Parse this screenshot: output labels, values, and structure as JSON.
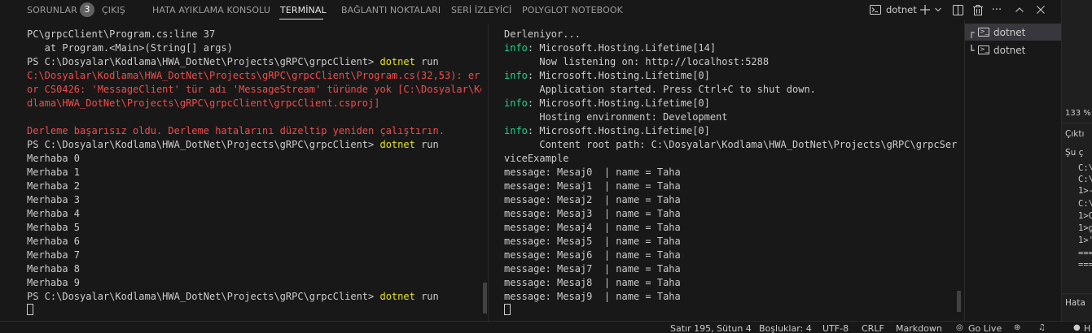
{
  "tabs": {
    "problems": "SORUNLAR",
    "problems_count": "3",
    "output": "ÇIKIŞ",
    "debug_console": "HATA AYIKLAMA KONSOLU",
    "terminal": "TERMİNAL",
    "ports": "BAĞLANTI NOKTALARI",
    "serial_monitor": "SERİ İZLEYİCİ",
    "polyglot": "POLYGLOT NOTEBOOK"
  },
  "toolbar": {
    "terminal_name": "dotnet"
  },
  "left_terminal": {
    "lines": [
      {
        "t": "PC\\grpcClient\\Program.cs:line 37",
        "c": "default"
      },
      {
        "t": "   at Program.<Main>(String[] args)",
        "c": "default"
      },
      {
        "t": "PS C:\\Dosyalar\\Kodlama\\HWA_DotNet\\Projects\\gRPC\\grpcClient> ",
        "c": "default",
        "cmd": "dotnet",
        "arg": " run"
      },
      {
        "t": "C:\\Dosyalar\\Kodlama\\HWA_DotNet\\Projects\\gRPC\\grpcClient\\Program.cs(32,53): err",
        "c": "err"
      },
      {
        "t": "or CS0426: 'MessageClient' tür adı 'MessageStream' türünde yok [C:\\Dosyalar\\Ko",
        "c": "err"
      },
      {
        "t": "dlama\\HWA_DotNet\\Projects\\gRPC\\grpcClient\\grpcClient.csproj]",
        "c": "err"
      },
      {
        "t": "",
        "c": "default"
      },
      {
        "t": "Derleme başarısız oldu. Derleme hatalarını düzeltip yeniden çalıştırın.",
        "c": "err"
      },
      {
        "t": "PS C:\\Dosyalar\\Kodlama\\HWA_DotNet\\Projects\\gRPC\\grpcClient> ",
        "c": "default",
        "cmd": "dotnet",
        "arg": " run"
      },
      {
        "t": "Merhaba 0",
        "c": "default"
      },
      {
        "t": "Merhaba 1",
        "c": "default"
      },
      {
        "t": "Merhaba 2",
        "c": "default"
      },
      {
        "t": "Merhaba 3",
        "c": "default"
      },
      {
        "t": "Merhaba 4",
        "c": "default"
      },
      {
        "t": "Merhaba 5",
        "c": "default"
      },
      {
        "t": "Merhaba 6",
        "c": "default"
      },
      {
        "t": "Merhaba 7",
        "c": "default"
      },
      {
        "t": "Merhaba 8",
        "c": "default"
      },
      {
        "t": "Merhaba 9",
        "c": "default"
      },
      {
        "t": "PS C:\\Dosyalar\\Kodlama\\HWA_DotNet\\Projects\\gRPC\\grpcClient> ",
        "c": "default",
        "cmd": "dotnet",
        "arg": " run"
      }
    ]
  },
  "right_terminal": {
    "lines": [
      {
        "t": "Derleniyor...",
        "c": "default"
      },
      {
        "info": "info",
        "t": ": Microsoft.Hosting.Lifetime[14]"
      },
      {
        "t": "      Now listening on: http://localhost:5288",
        "c": "default"
      },
      {
        "info": "info",
        "t": ": Microsoft.Hosting.Lifetime[0]"
      },
      {
        "t": "      Application started. Press Ctrl+C to shut down.",
        "c": "default"
      },
      {
        "info": "info",
        "t": ": Microsoft.Hosting.Lifetime[0]"
      },
      {
        "t": "      Hosting environment: Development",
        "c": "default"
      },
      {
        "info": "info",
        "t": ": Microsoft.Hosting.Lifetime[0]"
      },
      {
        "t": "      Content root path: C:\\Dosyalar\\Kodlama\\HWA_DotNet\\Projects\\gRPC\\grpcSer",
        "c": "default"
      },
      {
        "t": "viceExample",
        "c": "default"
      },
      {
        "t": "message: Mesaj0  | name = Taha",
        "c": "default"
      },
      {
        "t": "message: Mesaj1  | name = Taha",
        "c": "default"
      },
      {
        "t": "message: Mesaj2  | name = Taha",
        "c": "default"
      },
      {
        "t": "message: Mesaj3  | name = Taha",
        "c": "default"
      },
      {
        "t": "message: Mesaj4  | name = Taha",
        "c": "default"
      },
      {
        "t": "message: Mesaj5  | name = Taha",
        "c": "default"
      },
      {
        "t": "message: Mesaj6  | name = Taha",
        "c": "default"
      },
      {
        "t": "message: Mesaj7  | name = Taha",
        "c": "default"
      },
      {
        "t": "message: Mesaj8  | name = Taha",
        "c": "default"
      },
      {
        "t": "message: Mesaj9  | name = Taha",
        "c": "default"
      }
    ]
  },
  "terminal_list": [
    {
      "bracket": "┏",
      "label": "dotnet"
    },
    {
      "bracket": "┗",
      "label": "dotnet"
    }
  ],
  "side_panel": {
    "zoom": "133 %",
    "title": "Çıktı",
    "subtitle": "Şu ç",
    "lines": [
      "C:\\",
      "C:\\",
      "1>-",
      "C:\\",
      "1>C",
      "1>g",
      "1>'",
      "===",
      "==="
    ],
    "bottom": "Hata",
    "status_cut": "H"
  },
  "statusbar": {
    "position": "Satır 195, Sütun 4",
    "spaces": "Boşluklar: 4",
    "encoding": "UTF-8",
    "eol": "CRLF",
    "language": "Markdown",
    "golive": "Go Live"
  },
  "colors": {
    "error": "#f14c4c",
    "command": "#e5e510",
    "info": "#23d18b"
  }
}
